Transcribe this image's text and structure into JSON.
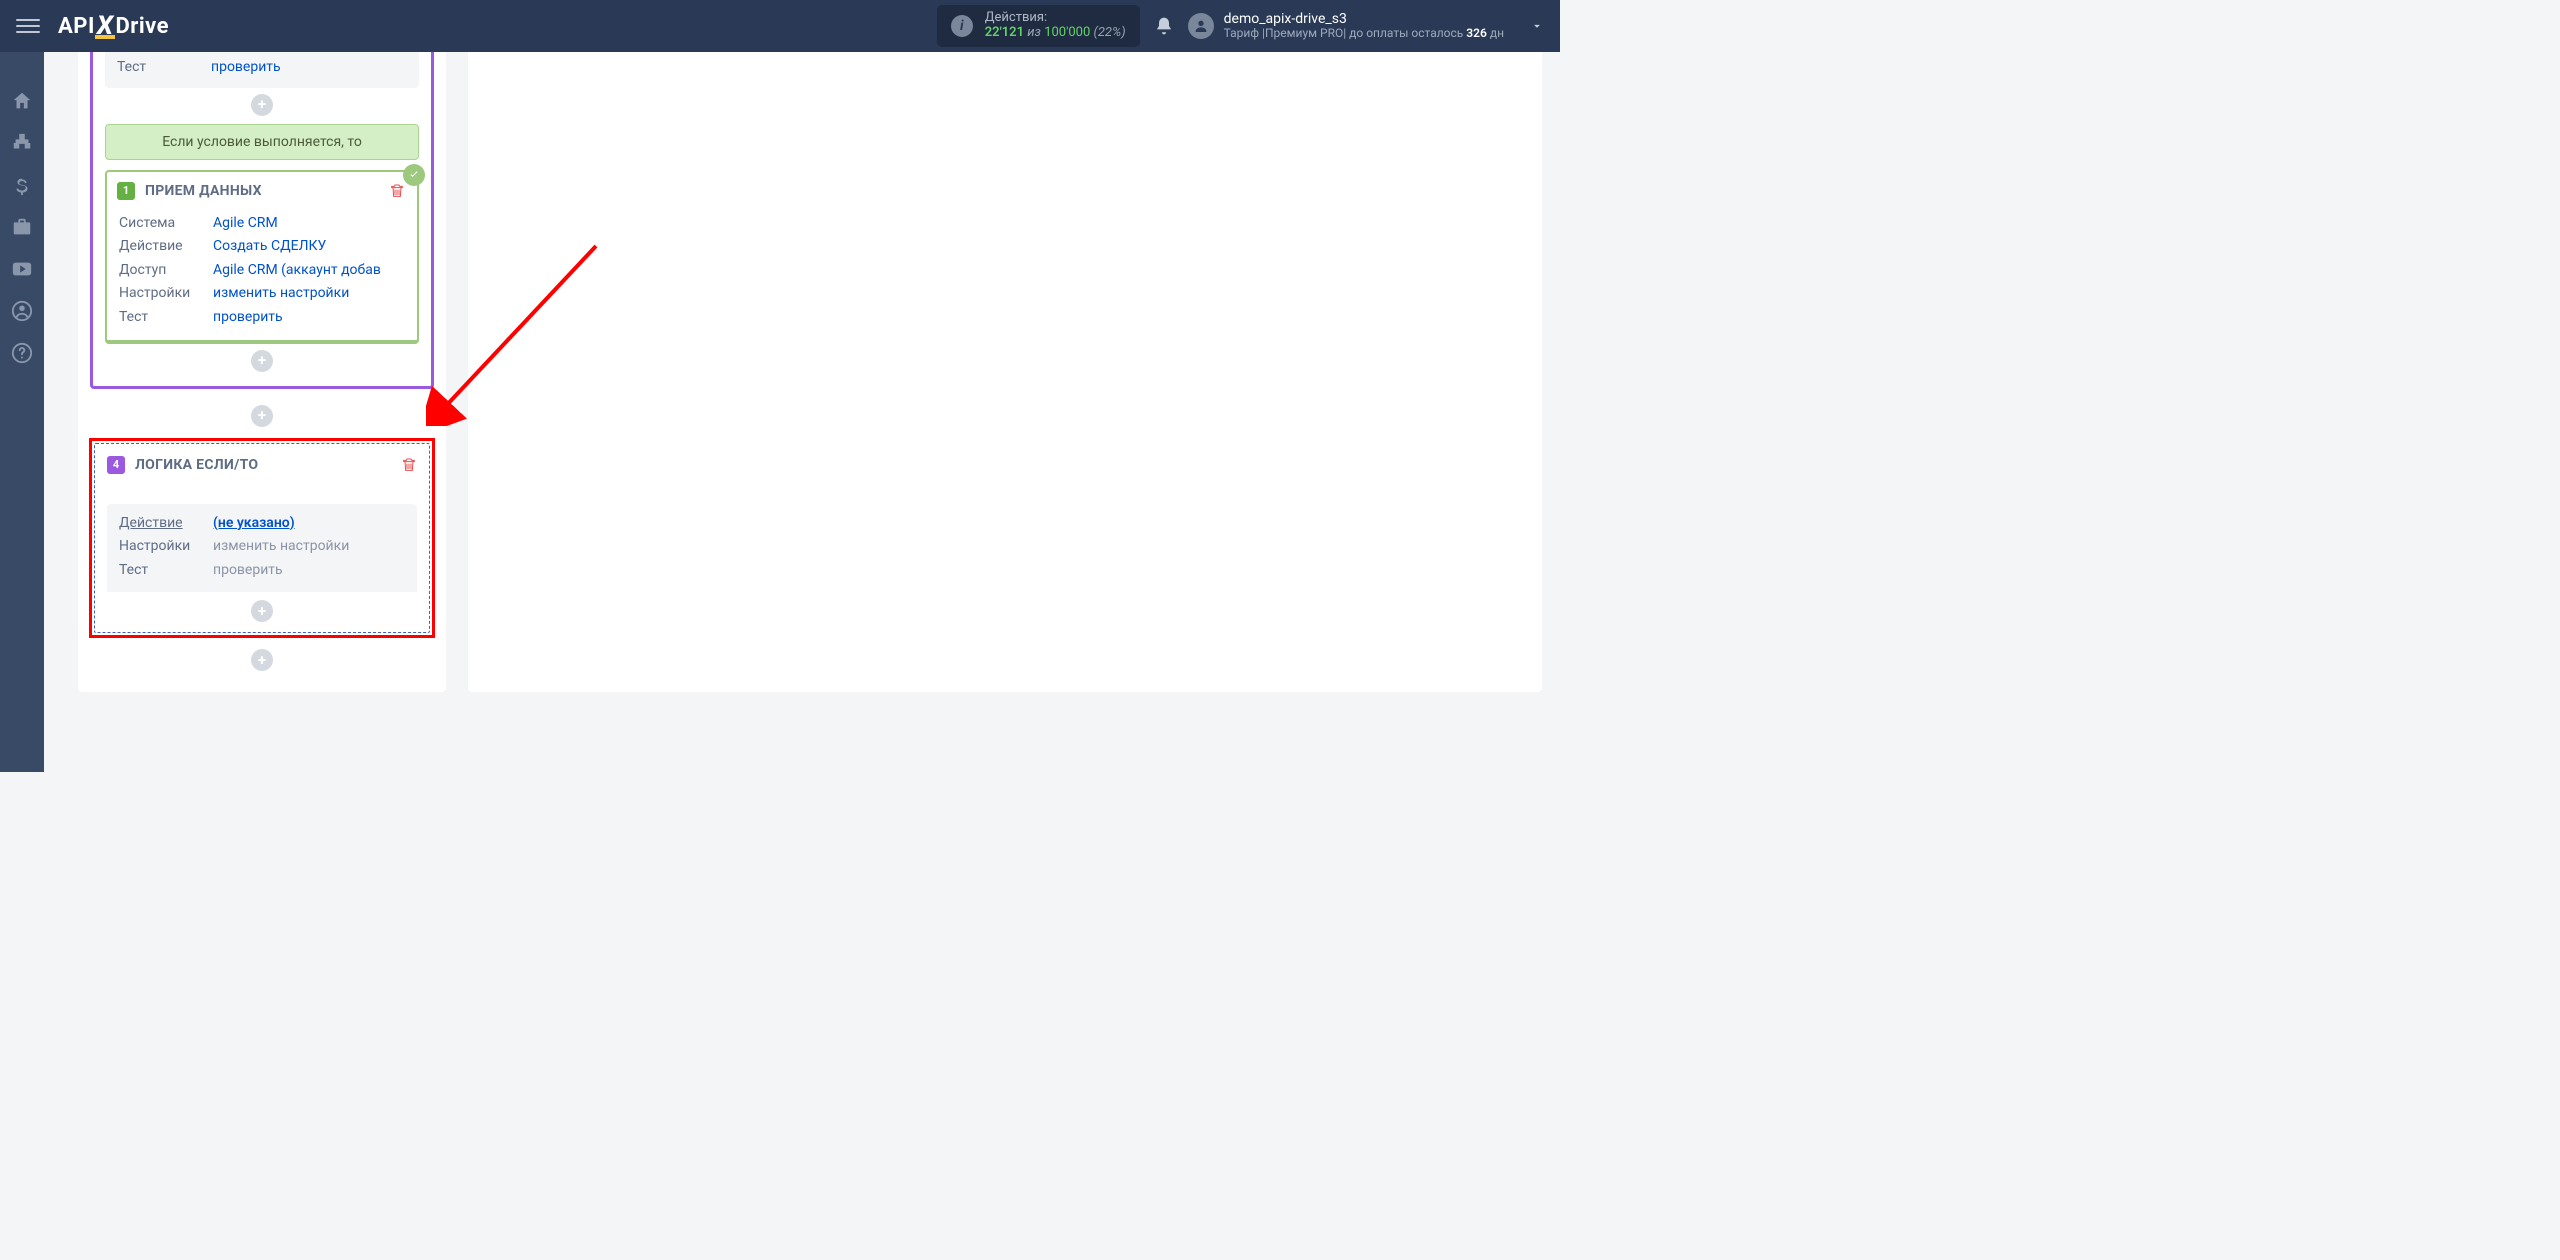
{
  "header": {
    "brand_api": "API",
    "brand_x": "X",
    "brand_drive": "Drive",
    "actions_label": "Действия:",
    "actions_used": "22'121",
    "actions_of": "из",
    "actions_total": "100'000",
    "actions_pct": "(22%)",
    "user_name": "demo_apix-drive_s3",
    "plan_prefix": "Тариф |Премиум PRO| до оплаты осталось ",
    "plan_days": "326",
    "plan_suffix": " дн"
  },
  "condition_true_label": "Если условие выполняется, то",
  "card1": {
    "num": "1",
    "title": "ПРИЕМ ДАННЫХ",
    "rows": {
      "system_k": "Система",
      "system_v": "Agile CRM",
      "action_k": "Действие",
      "action_v": "Создать СДЕЛКУ",
      "access_k": "Доступ",
      "access_v": "Agile CRM (аккаунт добав",
      "settings_k": "Настройки",
      "settings_v": "изменить настройки",
      "test_k": "Тест",
      "test_v": "проверить"
    }
  },
  "partial_card": {
    "test_k": "Тест",
    "test_v": "проверить"
  },
  "card4": {
    "num": "4",
    "title": "ЛОГИКА ЕСЛИ/ТО",
    "rows": {
      "action_k": "Действие",
      "action_v": "(не указано)",
      "settings_k": "Настройки",
      "settings_v": "изменить настройки",
      "test_k": "Тест",
      "test_v": "проверить"
    }
  }
}
